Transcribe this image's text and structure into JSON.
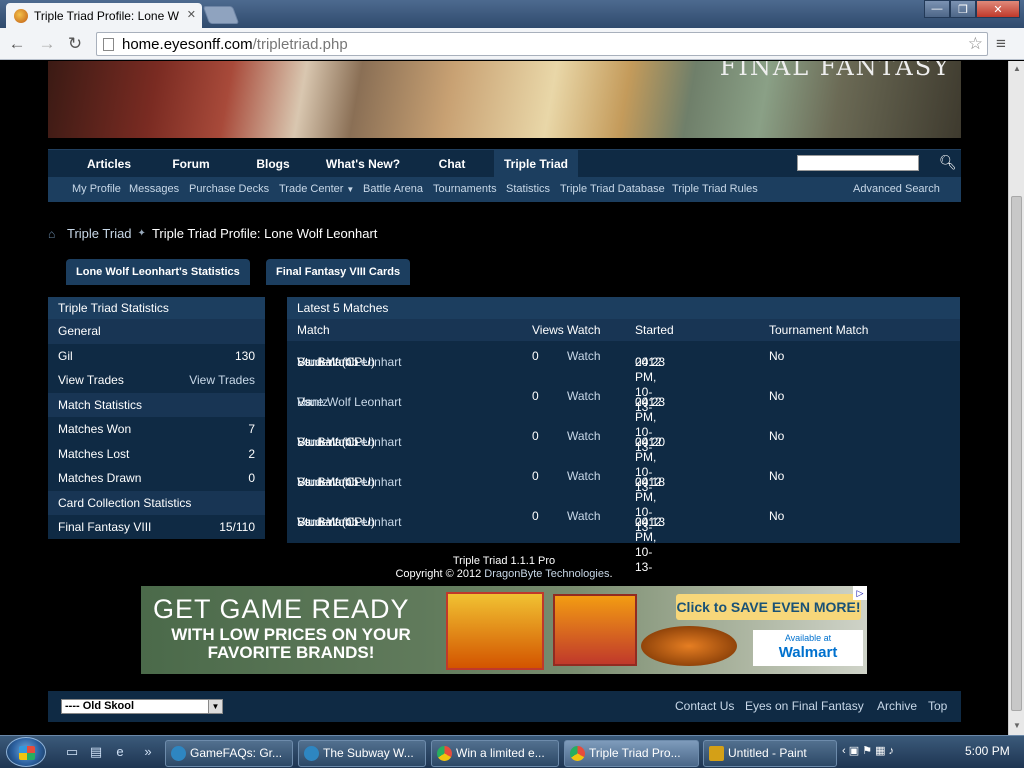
{
  "browser": {
    "tab_title": "Triple Triad Profile: Lone W",
    "url_host": "home.eyesonff.com",
    "url_path": "/tripletriad.php"
  },
  "site": {
    "banner_logo": "FINAL FANTASY",
    "nav": [
      "Articles",
      "Forum",
      "Blogs",
      "What's New?",
      "Chat",
      "Triple Triad"
    ],
    "subnav": [
      "My Profile",
      "Messages",
      "Purchase Decks",
      "Trade Center",
      "Battle Arena",
      "Tournaments",
      "Statistics",
      "Triple Triad Database",
      "Triple Triad Rules"
    ],
    "advanced_search": "Advanced Search"
  },
  "breadcrumb": {
    "root": "Triple Triad",
    "current": "Triple Triad Profile: Lone Wolf Leonhart"
  },
  "tabs": [
    "Lone Wolf Leonhart's Statistics",
    "Final Fantasy VIII Cards"
  ],
  "stats": {
    "title": "Triple Triad Statistics",
    "general": "General",
    "gil_label": "Gil",
    "gil_value": "130",
    "view_trades_label": "View Trades",
    "view_trades_link": "View Trades",
    "match_stats": "Match Statistics",
    "won_label": "Matches Won",
    "won_value": "7",
    "lost_label": "Matches Lost",
    "lost_value": "2",
    "drawn_label": "Matches Drawn",
    "drawn_value": "0",
    "card_stats": "Card Collection Statistics",
    "ff8_label": "Final Fantasy VIII",
    "ff8_value": "15/110"
  },
  "matches": {
    "title": "Latest 5 Matches",
    "headers": {
      "match": "Match",
      "views": "Views",
      "watch": "Watch",
      "started": "Started",
      "tournament": "Tournament Match"
    },
    "rows": [
      {
        "p1": "Lone Wolf Leonhart",
        "vs": " Vs. Balamb",
        "p2": "Student (CPU)",
        "views": "0",
        "watch": "Watch",
        "started1": "04:23 PM, 10-13-",
        "started2": "2012",
        "tournament": "No"
      },
      {
        "p1": "Rantz",
        "vs": " Vs. ",
        "p2_link": "Lone Wolf Leonhart",
        "views": "0",
        "watch": "Watch",
        "started1": "04:23 PM, 10-13-",
        "started2": "2012",
        "tournament": "No"
      },
      {
        "p1": "Lone Wolf Leonhart",
        "vs": " Vs. Balamb",
        "p2": "Student (CPU)",
        "views": "0",
        "watch": "Watch",
        "started1": "04:20 PM, 10-13-",
        "started2": "2012",
        "tournament": "No"
      },
      {
        "p1": "Lone Wolf Leonhart",
        "vs": " Vs. Balamb",
        "p2": "Student (CPU)",
        "views": "0",
        "watch": "Watch",
        "started1": "04:18 PM, 10-13-",
        "started2": "2012",
        "tournament": "No"
      },
      {
        "p1": "Lone Wolf Leonhart",
        "vs": " Vs. Balamb",
        "p2": "Student (CPU)",
        "views": "0",
        "watch": "Watch",
        "started1": "04:13 PM, 10-13-",
        "started2": "2012",
        "tournament": "No"
      }
    ]
  },
  "footer": {
    "version": "Triple Triad 1.1.1 Pro",
    "copyright_pre": "Copyright © 2012 ",
    "copyright_link": "DragonByte Technologies",
    "copyright_post": ".",
    "style_select": "---- Old Skool",
    "links": [
      "Contact Us",
      "Eyes on Final Fantasy",
      "Archive",
      "Top"
    ]
  },
  "ad": {
    "line1": "GET GAME READY",
    "line2": "WITH LOW PRICES ON YOUR FAVORITE BRANDS!",
    "cta": "Click to SAVE EVEN MORE!",
    "walmart_small": "Available at",
    "walmart": "Walmart"
  },
  "taskbar": {
    "tasks": [
      "GameFAQs: Gr...",
      "The Subway W...",
      "Win a limited e...",
      "Triple Triad Pro...",
      "Untitled - Paint"
    ],
    "clock": "5:00 PM"
  },
  "colors": {
    "nav_bg": "#0f2a44",
    "nav_active": "#1c3e5f",
    "link": "#c8d8e8"
  }
}
